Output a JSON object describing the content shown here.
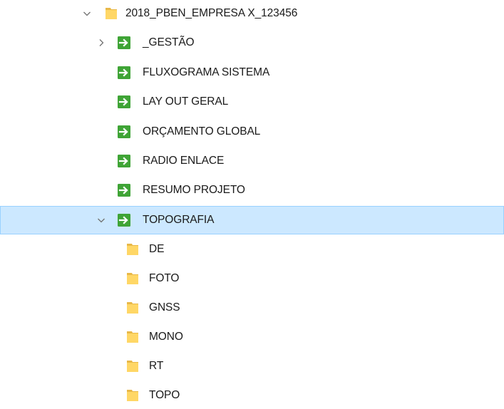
{
  "tree": {
    "root": {
      "label": "2018_PBEN_EMPRESA X_123456",
      "icon": "folder-icon",
      "expanded": true
    },
    "items": [
      {
        "label": "_GESTÃO",
        "icon": "shortcut-icon",
        "chevron": "right"
      },
      {
        "label": "FLUXOGRAMA SISTEMA",
        "icon": "shortcut-icon"
      },
      {
        "label": "LAY OUT GERAL",
        "icon": "shortcut-icon"
      },
      {
        "label": "ORÇAMENTO GLOBAL",
        "icon": "shortcut-icon"
      },
      {
        "label": "RADIO ENLACE",
        "icon": "shortcut-icon"
      },
      {
        "label": "RESUMO PROJETO",
        "icon": "shortcut-icon"
      },
      {
        "label": "TOPOGRAFIA",
        "icon": "shortcut-icon",
        "chevron": "down",
        "selected": true
      }
    ],
    "children": [
      {
        "label": "DE",
        "icon": "folder-icon"
      },
      {
        "label": "FOTO",
        "icon": "folder-icon"
      },
      {
        "label": "GNSS",
        "icon": "folder-icon"
      },
      {
        "label": "MONO",
        "icon": "folder-icon"
      },
      {
        "label": "RT",
        "icon": "folder-icon"
      },
      {
        "label": "TOPO",
        "icon": "folder-icon"
      }
    ]
  },
  "colors": {
    "folder": "#ffd766",
    "folder_dark": "#e8b848",
    "shortcut_green": "#3fa436",
    "selection_bg": "#cce8ff",
    "selection_border": "#99d1ff",
    "chevron": "#707070"
  }
}
